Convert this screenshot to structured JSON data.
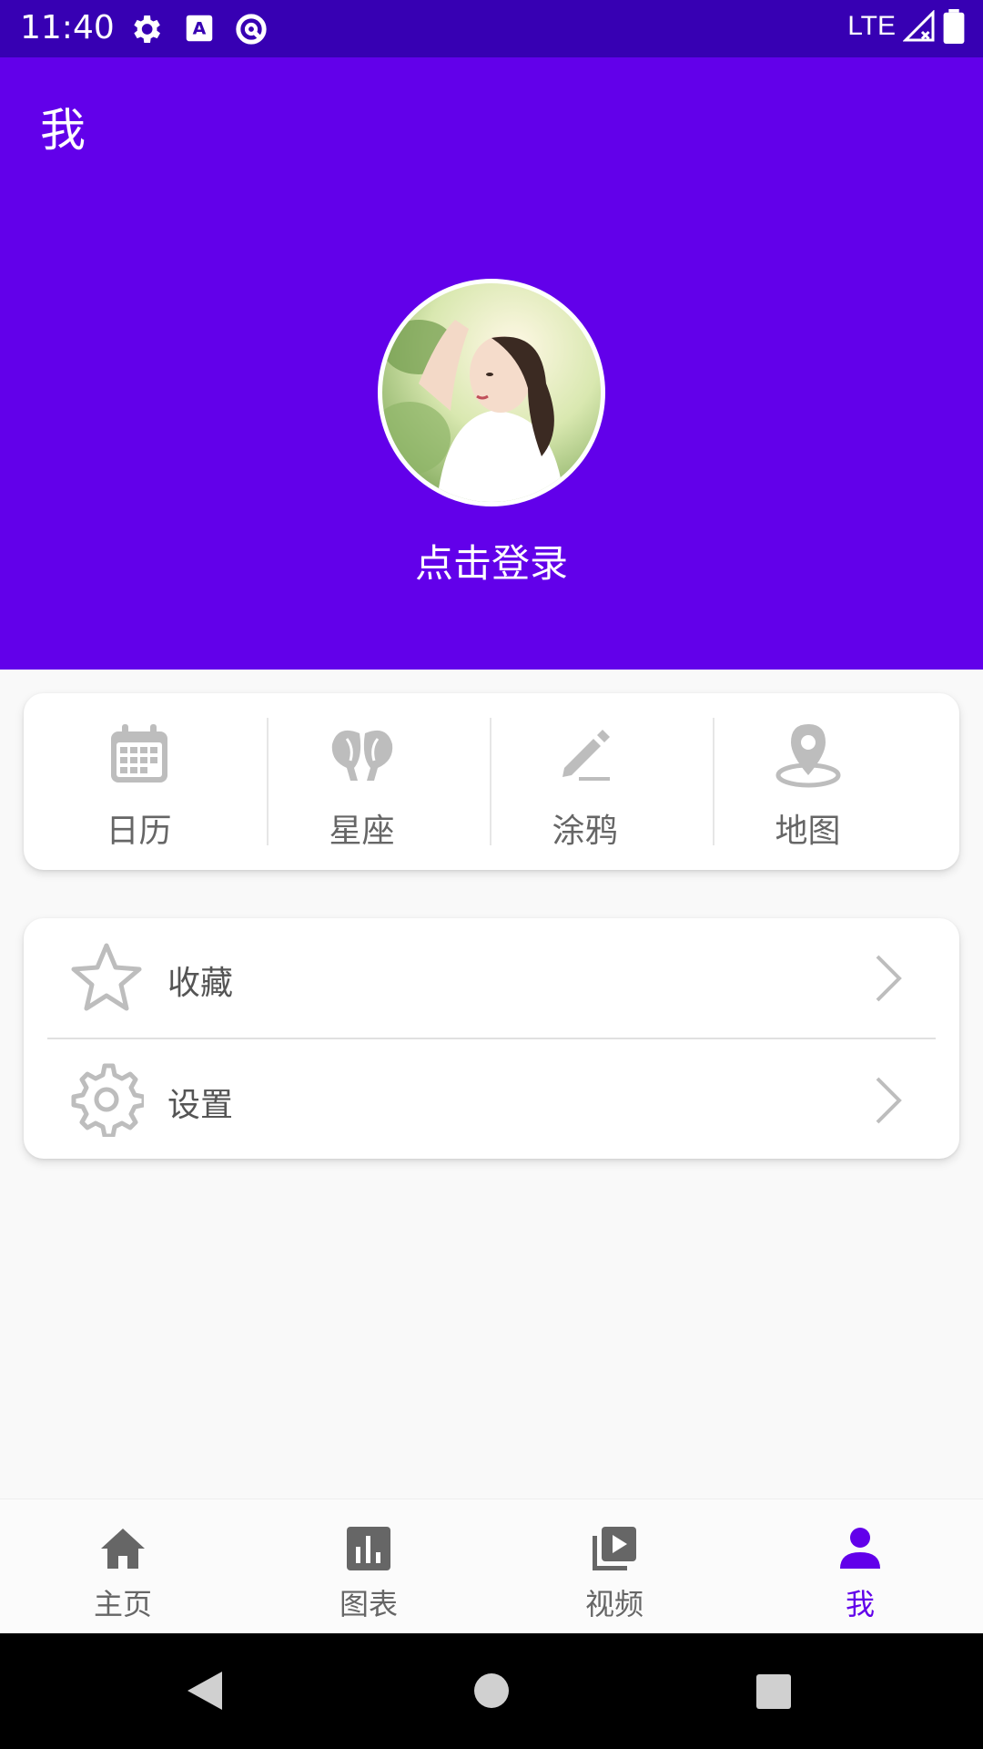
{
  "status_bar": {
    "time": "11:40",
    "network": "LTE"
  },
  "app_bar": {
    "title": "我"
  },
  "profile": {
    "login_text": "点击登录",
    "avatar_alt": "avatar photo"
  },
  "quick_actions": [
    {
      "label": "日历",
      "icon": "calendar-icon"
    },
    {
      "label": "星座",
      "icon": "constellation-icon"
    },
    {
      "label": "涂鸦",
      "icon": "pencil-icon"
    },
    {
      "label": "地图",
      "icon": "map-pin-icon"
    }
  ],
  "menu": [
    {
      "label": "收藏",
      "icon": "star-icon"
    },
    {
      "label": "设置",
      "icon": "gear-icon"
    }
  ],
  "bottom_nav": [
    {
      "label": "主页",
      "icon": "home-icon",
      "active": false
    },
    {
      "label": "图表",
      "icon": "chart-icon",
      "active": false
    },
    {
      "label": "视频",
      "icon": "video-icon",
      "active": false
    },
    {
      "label": "我",
      "icon": "person-icon",
      "active": true
    }
  ],
  "colors": {
    "primary": "#6200ea",
    "primary_dark": "#3700b3",
    "icon_gray": "#b8b8b8",
    "nav_gray": "#666666"
  }
}
